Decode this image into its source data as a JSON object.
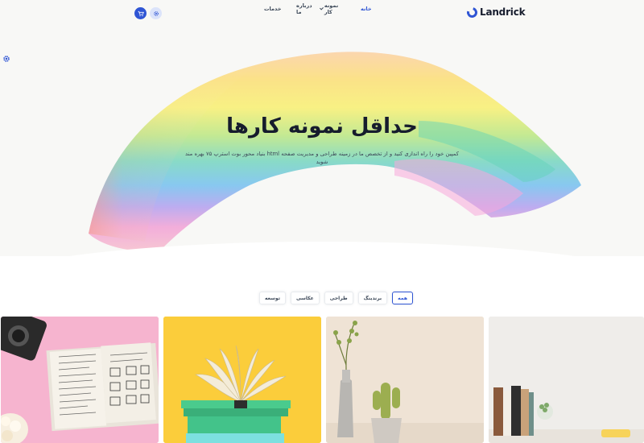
{
  "brand": {
    "name": "Landrick"
  },
  "nav": {
    "items": [
      {
        "label": "خانه",
        "active": true
      },
      {
        "label": "نمونه کار",
        "has_dropdown": true
      },
      {
        "label": "درباره ما"
      },
      {
        "label": "خدمات"
      }
    ],
    "icons": [
      "cart-icon",
      "settings-icon"
    ]
  },
  "hero": {
    "title": "حداقل نمونه کارها",
    "subtitle": "کمپین خود را راه اندازی کنید و از تخصص ما در زمینه طراحی و مدیریت صفحه html بنیاد محور بوت استرپ ۷۵ بهره مند شوید"
  },
  "filters": [
    {
      "label": "همه",
      "active": true
    },
    {
      "label": "برندینگ"
    },
    {
      "label": "طراحی"
    },
    {
      "label": "عکاسی"
    },
    {
      "label": "توسعه"
    }
  ],
  "portfolio": {
    "items": [
      {
        "image": "notebook-camera-photo"
      },
      {
        "image": "open-book-yellow-photo"
      },
      {
        "image": "vase-cactus-photo"
      },
      {
        "image": "books-shelf-photo"
      }
    ]
  },
  "colors": {
    "primary": "#2f55d4",
    "text": "#3c4858",
    "dark": "#161c2d"
  }
}
